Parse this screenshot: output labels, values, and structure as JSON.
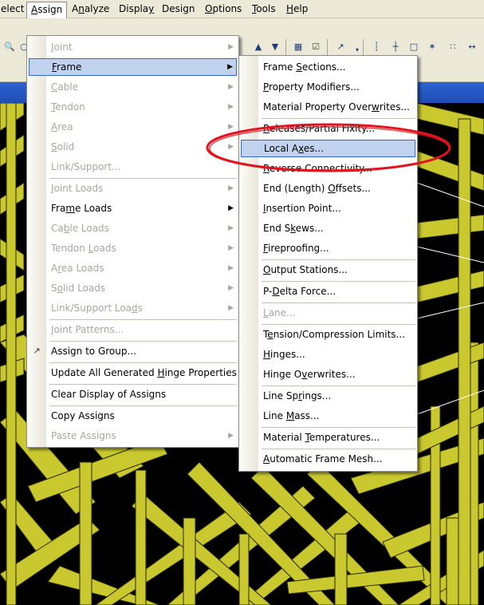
{
  "menubar": {
    "items": [
      "elect",
      "Assign",
      "Analyze",
      "Display",
      "Design",
      "Options",
      "Tools",
      "Help"
    ]
  },
  "assign_menu": {
    "items": [
      {
        "label": "Joint",
        "enabled": false,
        "submenu": true
      },
      {
        "label": "Frame",
        "enabled": true,
        "submenu": true,
        "highlighted": true
      },
      {
        "label": "Cable",
        "enabled": false,
        "submenu": true
      },
      {
        "label": "Tendon",
        "enabled": false,
        "submenu": true
      },
      {
        "label": "Area",
        "enabled": false,
        "submenu": true
      },
      {
        "label": "Solid",
        "enabled": false,
        "submenu": true
      },
      {
        "label": "Link/Support...",
        "enabled": false,
        "submenu": false
      },
      {
        "label": "Joint Loads",
        "enabled": false,
        "submenu": true
      },
      {
        "label": "Frame Loads",
        "enabled": true,
        "submenu": true
      },
      {
        "label": "Cable Loads",
        "enabled": false,
        "submenu": true
      },
      {
        "label": "Tendon Loads",
        "enabled": false,
        "submenu": true
      },
      {
        "label": "Area Loads",
        "enabled": false,
        "submenu": true
      },
      {
        "label": "Solid Loads",
        "enabled": false,
        "submenu": true
      },
      {
        "label": "Link/Support Loads",
        "enabled": false,
        "submenu": true
      },
      {
        "label": "Joint Patterns...",
        "enabled": false,
        "submenu": false
      },
      {
        "label": "Assign to Group...",
        "enabled": true,
        "submenu": false,
        "icon": "group-icon"
      },
      {
        "label": "Update All Generated Hinge Properties",
        "enabled": true,
        "submenu": false
      },
      {
        "label": "Clear Display of Assigns",
        "enabled": true,
        "submenu": false
      },
      {
        "label": "Copy Assigns",
        "enabled": true,
        "submenu": false
      },
      {
        "label": "Paste Assigns",
        "enabled": false,
        "submenu": true
      }
    ]
  },
  "frame_submenu": {
    "items": [
      {
        "label": "Frame Sections...",
        "enabled": true
      },
      {
        "label": "Property Modifiers...",
        "enabled": true
      },
      {
        "label": "Material Property Overwrites...",
        "enabled": true
      },
      {
        "label": "Releases/Partial Fixity...",
        "enabled": true
      },
      {
        "label": "Local Axes...",
        "enabled": true,
        "highlighted": true
      },
      {
        "label": "Reverse Connectivity...",
        "enabled": true
      },
      {
        "label": "End (Length) Offsets...",
        "enabled": true
      },
      {
        "label": "Insertion Point...",
        "enabled": true
      },
      {
        "label": "End Skews...",
        "enabled": true
      },
      {
        "label": "Fireproofing...",
        "enabled": true
      },
      {
        "label": "Output Stations...",
        "enabled": true
      },
      {
        "label": "P-Delta Force...",
        "enabled": true
      },
      {
        "label": "Lane...",
        "enabled": false
      },
      {
        "label": "Tension/Compression Limits...",
        "enabled": true
      },
      {
        "label": "Hinges...",
        "enabled": true
      },
      {
        "label": "Hinge Overwrites...",
        "enabled": true
      },
      {
        "label": "Line Springs...",
        "enabled": true
      },
      {
        "label": "Line Mass...",
        "enabled": true
      },
      {
        "label": "Material Temperatures...",
        "enabled": true
      },
      {
        "label": "Automatic Frame Mesh...",
        "enabled": true
      }
    ]
  },
  "colors": {
    "menubar_bg": "#ece9d8",
    "menu_highlight": "#c1d2ee",
    "highlight_border": "#316ac5",
    "disabled_text": "#a7a69f",
    "frame_members": "#c9c82e",
    "viewport_bg": "#000000",
    "annotation": "#e0141e"
  }
}
